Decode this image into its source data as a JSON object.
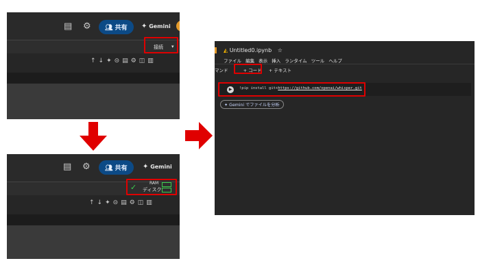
{
  "panel_top": {
    "share_label": "共有",
    "gemini_label": "Gemini",
    "connect_label": "接続"
  },
  "panel_bottom": {
    "share_label": "共有",
    "gemini_label": "Gemini",
    "ram_label": "RAM",
    "disk_label": "ディスク"
  },
  "notebook": {
    "title": "Untitled0.ipynb",
    "menu": [
      "ファイル",
      "編集",
      "表示",
      "挿入",
      "ランタイム",
      "ツール",
      "ヘルプ"
    ],
    "command_label": "マンド",
    "add_code_label": "+ コード",
    "add_text_label": "+ テキスト",
    "code_prefix": "!pip install git+",
    "code_url": "https://github.com/openai/whisper.git",
    "gemini_button": "Gemini でファイルを分析"
  },
  "colors": {
    "highlight": "#e00000",
    "share_bg": "#0c4a86",
    "arrow": "#e00000",
    "ram_ok": "#3ccf4e"
  }
}
